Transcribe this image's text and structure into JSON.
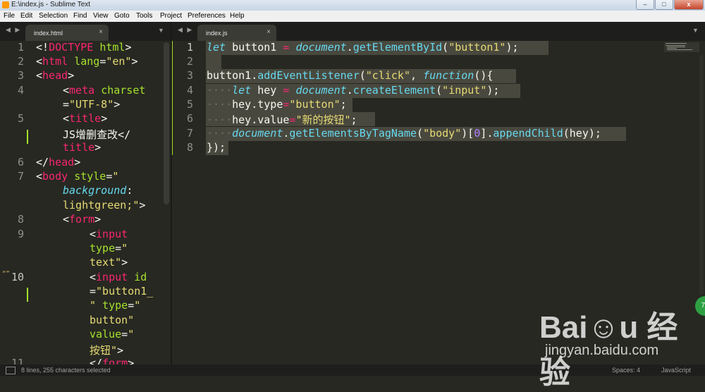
{
  "window": {
    "title": "E:\\index.js - Sublime Text",
    "minimize": "–",
    "maximize": "□",
    "close": "x"
  },
  "menu": [
    "File",
    "Edit",
    "Selection",
    "Find",
    "View",
    "Goto",
    "Tools",
    "Project",
    "Preferences",
    "Help"
  ],
  "tabs": {
    "left": {
      "nav": "◀ ▶",
      "label": "index.html",
      "close": "×",
      "menu": "▼"
    },
    "right": {
      "nav": "◀ ▶",
      "label": "index.js",
      "close": "×",
      "menu": "▼"
    }
  },
  "left_gutter": [
    "1",
    "2",
    "3",
    "4",
    "",
    "5",
    "",
    "",
    "6",
    "7",
    "",
    "",
    "8",
    "9",
    "",
    "",
    "10",
    "",
    "",
    "",
    "",
    "11"
  ],
  "left_bookmark": "“”",
  "right_gutter": [
    "1",
    "2",
    "3",
    "4",
    "5",
    "6",
    "7",
    "8"
  ],
  "status": {
    "text": "8 lines, 255 characters selected",
    "spaces": "Spaces: 4",
    "syntax": "JavaScript"
  },
  "watermark": {
    "brand": "Bai☺u 经验",
    "site": "jingyan.baidu.com"
  },
  "badge": "75",
  "colors": {
    "editor_bg": "#272822",
    "keyword": "#f92672",
    "string": "#e6db74",
    "attribute": "#a6e22e",
    "function": "#66d9ef",
    "number": "#ae81ff",
    "selection": "#49483e"
  }
}
